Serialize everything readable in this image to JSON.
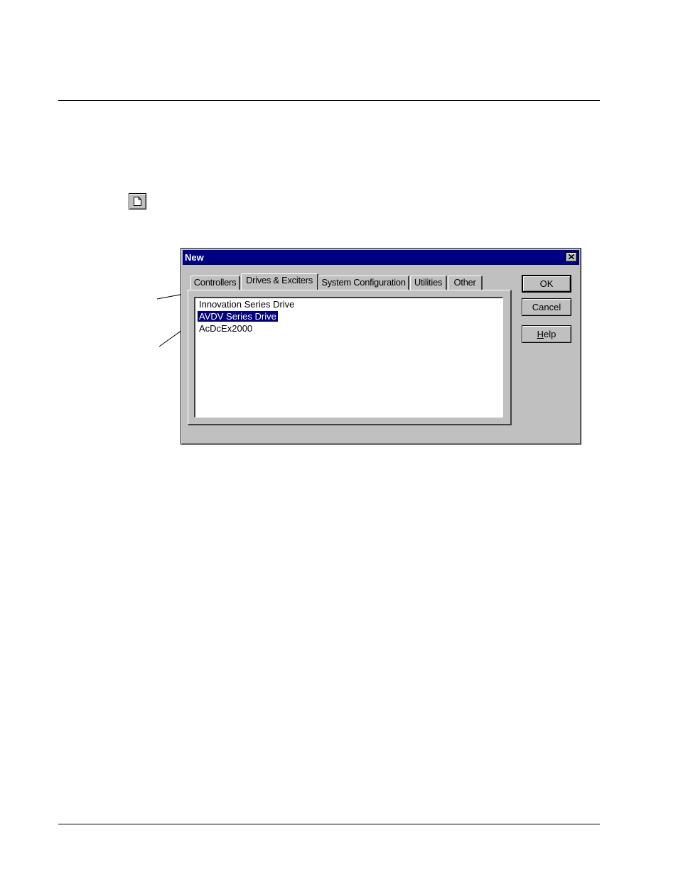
{
  "toolbar": {
    "new_button_icon": "new-document-icon"
  },
  "dialog": {
    "title": "New",
    "close_icon": "close-icon",
    "tabs": [
      {
        "label": "Controllers",
        "active": false
      },
      {
        "label": "Drives & Exciters",
        "active": true
      },
      {
        "label": "System Configuration",
        "active": false
      },
      {
        "label": "Utilities",
        "active": false
      },
      {
        "label": "Other",
        "active": false
      }
    ],
    "list_items": [
      {
        "label": "Innovation Series Drive",
        "selected": false
      },
      {
        "label": "AVDV Series Drive",
        "selected": true
      },
      {
        "label": "AcDcEx2000",
        "selected": false
      }
    ],
    "buttons": {
      "ok": "OK",
      "cancel": "Cancel",
      "help_accel": "H",
      "help_rest": "elp"
    }
  },
  "colors": {
    "dialog_face": "#c0c0c0",
    "titlebar": "#000080",
    "selection": "#000080"
  }
}
